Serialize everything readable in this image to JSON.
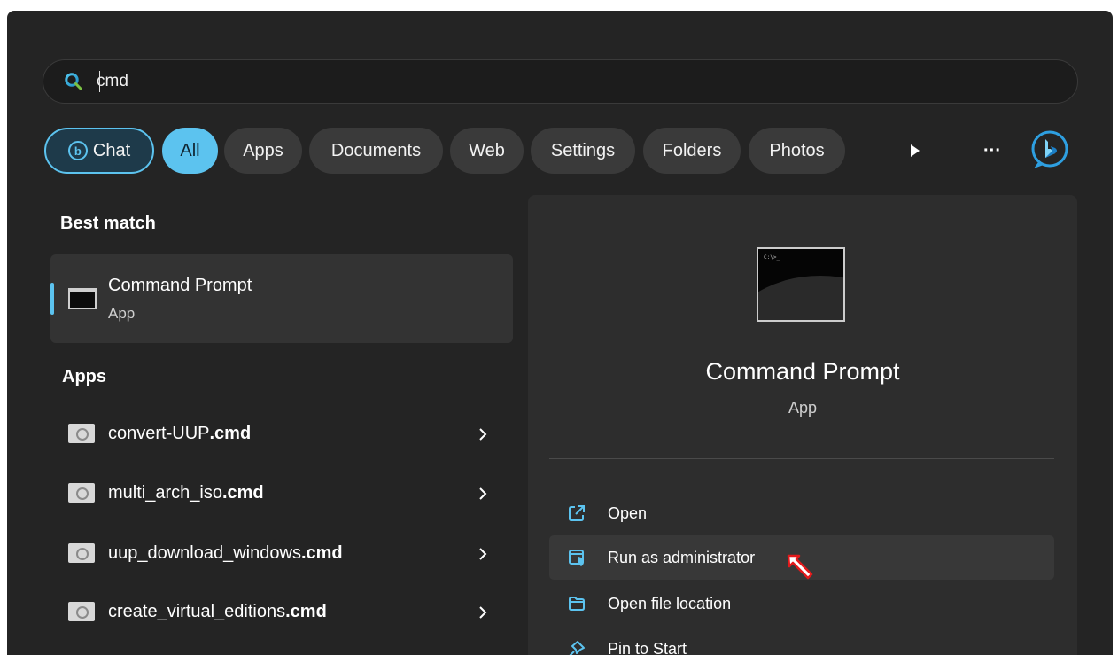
{
  "search": {
    "value": "cmd",
    "icon": "search-icon"
  },
  "filters": {
    "chat": "Chat",
    "all": "All",
    "apps": "Apps",
    "documents": "Documents",
    "web": "Web",
    "settings": "Settings",
    "folders": "Folders",
    "photos": "Photos",
    "more": "···"
  },
  "best_match": {
    "heading": "Best match",
    "title": "Command Prompt",
    "subtitle": "App"
  },
  "apps": {
    "heading": "Apps",
    "items": [
      {
        "name": "convert-UUP",
        "ext": ".cmd"
      },
      {
        "name": "multi_arch_iso",
        "ext": ".cmd"
      },
      {
        "name": "uup_download_windows",
        "ext": ".cmd"
      },
      {
        "name": "create_virtual_editions",
        "ext": ".cmd"
      }
    ]
  },
  "preview": {
    "thumb_text": "C:\\>_",
    "title": "Command Prompt",
    "subtitle": "App",
    "actions": [
      {
        "label": "Open",
        "icon": "open-external-icon"
      },
      {
        "label": "Run as administrator",
        "icon": "admin-shield-icon"
      },
      {
        "label": "Open file location",
        "icon": "folder-icon"
      },
      {
        "label": "Pin to Start",
        "icon": "pin-icon"
      }
    ]
  },
  "colors": {
    "accent": "#5cc3ef",
    "background": "#242424",
    "pointer": "#e3191b"
  }
}
